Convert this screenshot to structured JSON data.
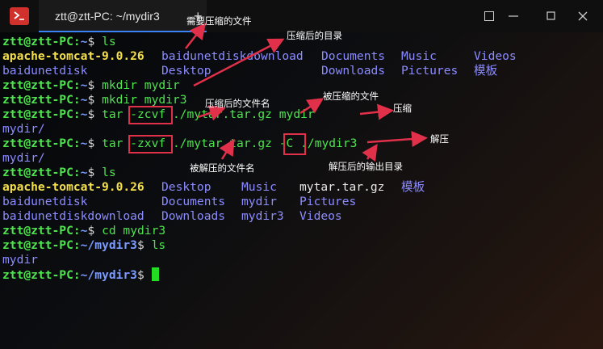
{
  "window": {
    "tab_title": "ztt@ztt-PC: ~/mydir3",
    "new_tab_symbol": "+",
    "accent_color": "#3b82f6",
    "icons": {
      "app": "terminal-icon",
      "close_tab": "close-icon",
      "menu": "menu-icon",
      "minimize": "minimize-icon",
      "maximize": "maximize-icon",
      "close": "close-icon"
    }
  },
  "prompt": {
    "user": "ztt@ztt-PC",
    "sep": ":",
    "home_path": "~",
    "mydir3_path": "~/mydir3",
    "dollar": "$"
  },
  "terminal": {
    "cmd_ls": "ls",
    "ls1_row1": [
      "apache-tomcat-9.0.26",
      "baidunetdiskdownload",
      "Documents",
      "Music",
      "Videos"
    ],
    "ls1_row2": [
      "baidunetdisk",
      "Desktop",
      "Downloads",
      "Pictures",
      "模板"
    ],
    "cmd_mkdir1": "mkdir mydir",
    "cmd_mkdir2": "mkdir mydir3",
    "cmd_tar_c": {
      "prog": "tar",
      "opt": "-zcvf",
      "rest": "./mytar.tar.gz mydir"
    },
    "out_tar_c": "mydir/",
    "cmd_tar_x": {
      "prog": "tar",
      "opt": "-zxvf",
      "archive": "./mytar.tar.gz",
      "dest_opt": "-C",
      "dest": "./mydir3"
    },
    "out_tar_x": "mydir/",
    "ls2_row1": [
      "apache-tomcat-9.0.26",
      "Desktop",
      "Music",
      "mytar.tar.gz",
      "模板"
    ],
    "ls2_row2": [
      "baidunetdisk",
      "Documents",
      "mydir",
      "Pictures"
    ],
    "ls2_row3": [
      "baidunetdiskdownload",
      "Downloads",
      "mydir3",
      "Videos"
    ],
    "cmd_cd": "cd mydir3",
    "cmd_ls2": "ls",
    "out_ls3": "mydir"
  },
  "annotations": {
    "need_compress_files": "需要压缩的文件",
    "compressed_dir": "压缩后的目录",
    "compressed_filename": "压缩后的文件名",
    "files_to_compress": "被压缩的文件",
    "compress": "压缩",
    "decompress": "解压",
    "decompressed_filename": "被解压的文件名",
    "decompress_output_dir": "解压后的输出目录"
  },
  "colors": {
    "annotation": "#e0304a",
    "prompt_user": "#4ee44e",
    "prompt_path": "#7b9bff",
    "directory": "#8c8cff",
    "archive_bold": "#f4e04d"
  }
}
